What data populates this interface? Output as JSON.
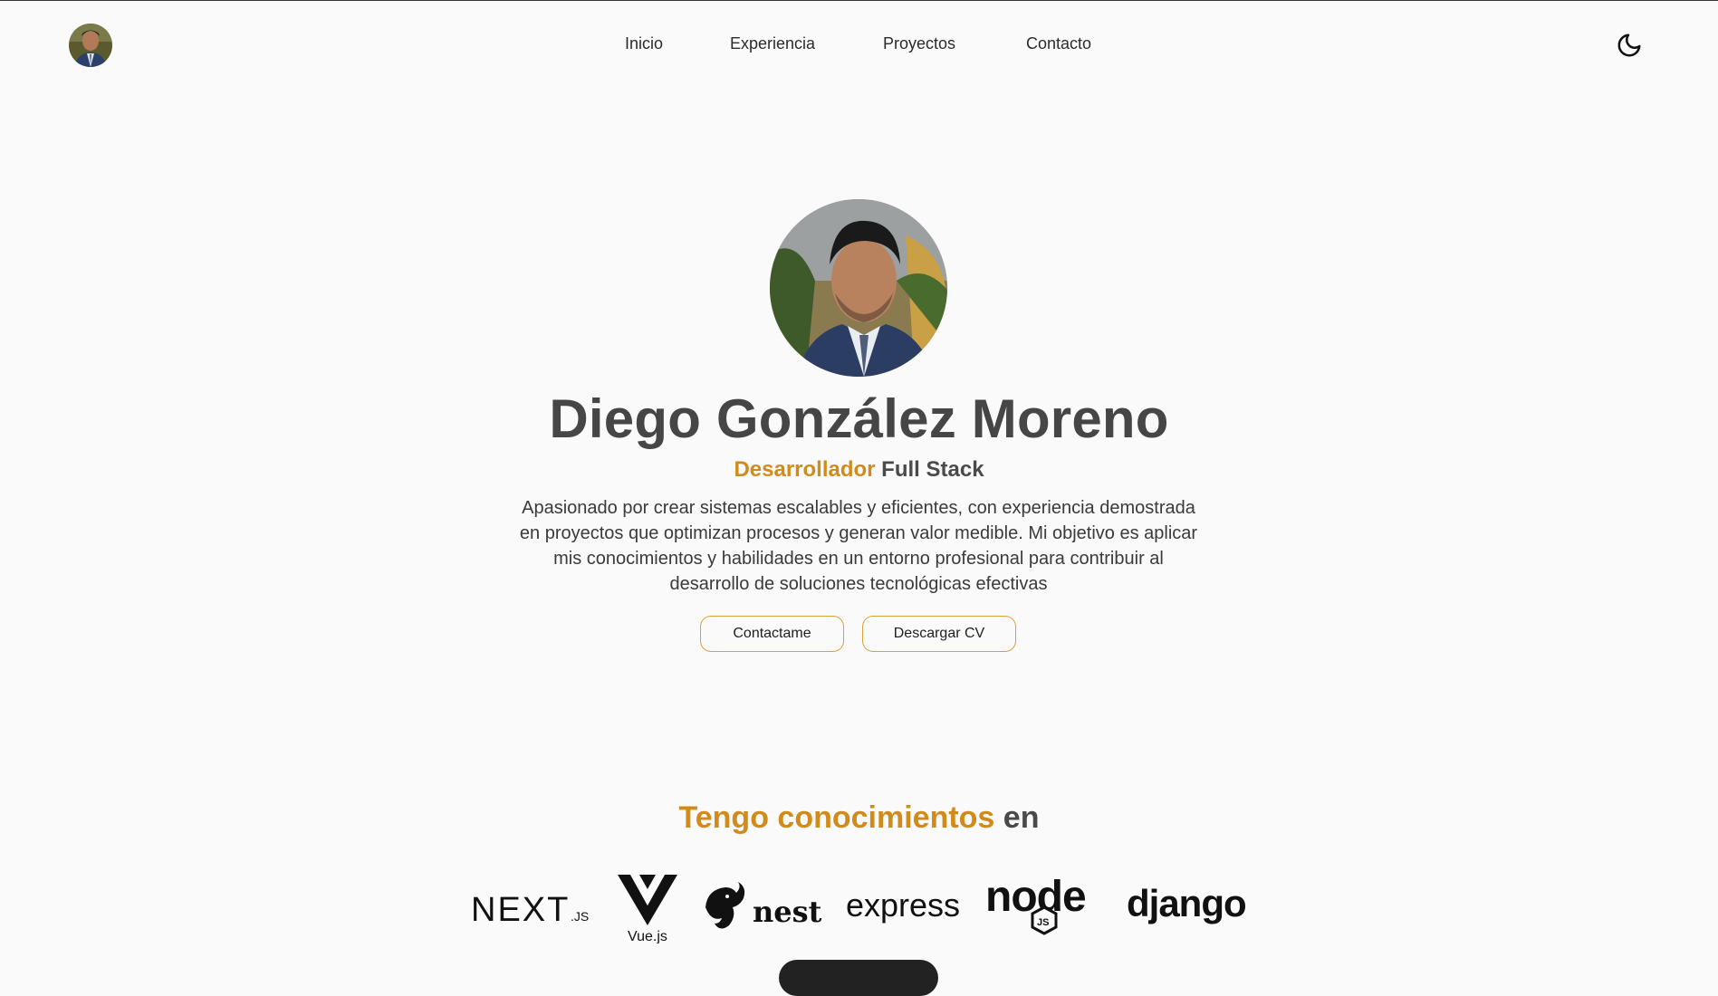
{
  "nav": {
    "items": [
      "Inicio",
      "Experiencia",
      "Proyectos",
      "Contacto"
    ]
  },
  "hero": {
    "name": "Diego González Moreno",
    "role_accent": "Desarrollador",
    "role_rest": "Full Stack",
    "description": "Apasionado por crear sistemas escalables y eficientes, con experiencia demostrada en proyectos que optimizan procesos y generan valor medible. Mi objetivo es aplicar mis conocimientos y habilidades en un entorno profesional para contribuir al desarrollo de soluciones tecnológicas efectivas",
    "buttons": {
      "contact": "Contactame",
      "cv": "Descargar CV"
    }
  },
  "skills": {
    "title_accent": "Tengo conocimientos",
    "title_rest": "en",
    "logos": [
      {
        "icon": "nextjs-logo",
        "text": "NEXT",
        "suffix": ".JS"
      },
      {
        "icon": "vuejs-logo",
        "text": "Vue.js"
      },
      {
        "icon": "nestjs-logo",
        "text": "nest"
      },
      {
        "icon": "express-logo",
        "text": "express"
      },
      {
        "icon": "nodejs-logo",
        "text": "node",
        "badge": "JS"
      },
      {
        "icon": "django-logo",
        "text": "django"
      }
    ]
  },
  "icons": {
    "theme_toggle": "moon-icon"
  },
  "colors": {
    "accent": "#d18b1c",
    "button_border": "#d6a23c",
    "background": "#fafafa",
    "text": "#464646"
  }
}
